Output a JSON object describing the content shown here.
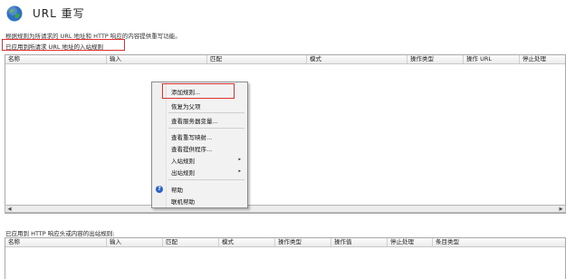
{
  "header": {
    "globe_icon": "globe-icon",
    "title": "URL 重写",
    "description": "根据规则为所请求的 URL 地址和 HTTP 响应的内容提供重写功能。"
  },
  "inbound": {
    "section_label": "已应用到所请求 URL 地址的入站规则",
    "columns": [
      "名称",
      "输入",
      "匹配",
      "模式",
      "操作类型",
      "操作 URL",
      "停止处理"
    ]
  },
  "context_menu": {
    "add_rule": "添加规则...",
    "restore_parent": "恢复为父项",
    "view_server_vars": "查看服务器变量...",
    "view_rewrite_maps": "查看重写映射...",
    "view_providers": "查看提供程序...",
    "inbound_rules": "入站规则",
    "outbound_rules": "出站规则",
    "help": "帮助",
    "online_help": "联机帮助",
    "submenu_arrow": "▸"
  },
  "outbound": {
    "section_label": "已应用到 HTTP 响应头或内容的出站规则:",
    "columns": [
      "名称",
      "输入",
      "匹配",
      "模式",
      "操作类型",
      "操作值",
      "停止处理",
      "条目类型"
    ]
  },
  "colors": {
    "highlight_border": "#e03030",
    "help_icon": "#2a63c7"
  }
}
